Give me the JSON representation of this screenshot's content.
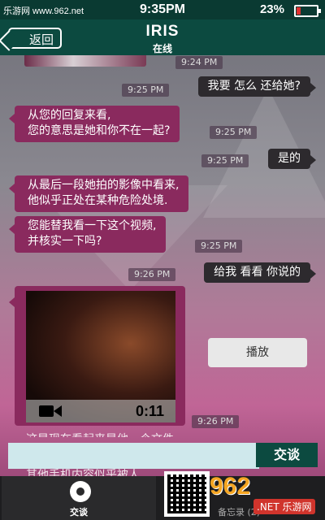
{
  "status_bar": {
    "watermark": "乐游网 www.962.net",
    "time": "9:35PM",
    "battery": "23%"
  },
  "header": {
    "back_label": "返回",
    "contact_name": "IRIS",
    "contact_status": "在线"
  },
  "messages": [
    {
      "from": "them",
      "time": "9:24 PM"
    },
    {
      "from": "me",
      "time": "9:25 PM",
      "text": "我要 怎么 还给她?"
    },
    {
      "from": "them",
      "time": "9:25 PM",
      "lines": [
        "从您的回复来看,",
        "您的意思是她和你不在一起?"
      ]
    },
    {
      "from": "me",
      "time": "9:25 PM",
      "text": "是的"
    },
    {
      "from": "them",
      "lines": [
        "从最后一段她拍的影像中看来,",
        "他似乎正处在某种危险处境."
      ]
    },
    {
      "from": "them",
      "time": "9:25 PM",
      "lines": [
        "您能替我看一下这个视频,",
        "并核实一下吗?"
      ]
    },
    {
      "from": "me",
      "time": "9:26 PM",
      "text": "给我 看看 你说的"
    },
    {
      "from": "them",
      "time": "9:26 PM",
      "video_duration": "0:11"
    }
  ],
  "play_label": "播放",
  "peek_lines": [
    "这是现在看起来是他一个文件",
    "其他手机内容似乎被人..."
  ],
  "composer": {
    "value": "",
    "send_label": "交谈"
  },
  "tabs": {
    "chat_label": "交谈",
    "notes_label": "备忘录 (2)"
  },
  "watermark": {
    "logo": "962",
    "site": ".NET 乐游网"
  },
  "colors": {
    "header": "#0c4a40",
    "incoming_bubble": "#8a2a5e",
    "outgoing_bubble": "#2d2a2e"
  }
}
